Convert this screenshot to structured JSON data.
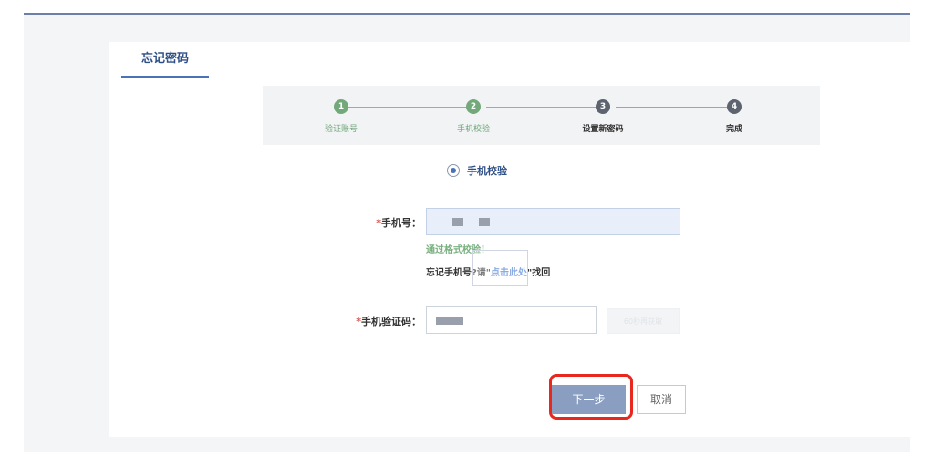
{
  "tab": {
    "label": "忘记密码"
  },
  "steps": [
    {
      "num": "1",
      "label": "验证账号"
    },
    {
      "num": "2",
      "label": "手机校验"
    },
    {
      "num": "3",
      "label": "设置新密码"
    },
    {
      "num": "4",
      "label": "完成"
    }
  ],
  "verify_method": {
    "label": "手机校验"
  },
  "phone": {
    "label": "手机号：",
    "required_mark": "*"
  },
  "validation": {
    "message": "通过格式校验！"
  },
  "forgot_phone": {
    "prefix": "忘记手机号?请\"",
    "link": "点击此处",
    "suffix": "\"找回"
  },
  "sms_code": {
    "label": "手机验证码：",
    "required_mark": "*",
    "button_label": "60秒再获取"
  },
  "actions": {
    "next": "下一步",
    "cancel": "取消"
  },
  "colors": {
    "accent": "#4a72b8",
    "success": "#73a97a",
    "highlight": "#e8281f",
    "primary_button": "#8a9ec2"
  }
}
